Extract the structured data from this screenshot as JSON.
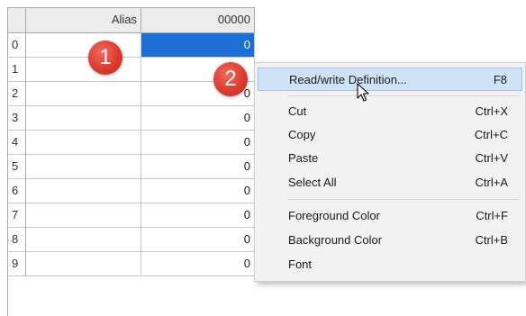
{
  "grid": {
    "columns": [
      "Alias",
      "00000"
    ],
    "rows": [
      {
        "index": "0",
        "alias": "",
        "value": "0",
        "selected": true
      },
      {
        "index": "1",
        "alias": "",
        "value": ""
      },
      {
        "index": "2",
        "alias": "",
        "value": "0"
      },
      {
        "index": "3",
        "alias": "",
        "value": "0"
      },
      {
        "index": "4",
        "alias": "",
        "value": "0"
      },
      {
        "index": "5",
        "alias": "",
        "value": "0"
      },
      {
        "index": "6",
        "alias": "",
        "value": "0"
      },
      {
        "index": "7",
        "alias": "",
        "value": "0"
      },
      {
        "index": "8",
        "alias": "",
        "value": "0"
      },
      {
        "index": "9",
        "alias": "",
        "value": "0"
      }
    ]
  },
  "badges": {
    "step1": "1",
    "step2": "2",
    "color": "#dd3b2e"
  },
  "context_menu": {
    "items": [
      {
        "label": "Read/write Definition...",
        "shortcut": "F8",
        "highlighted": true
      },
      {
        "label": "Cut",
        "shortcut": "Ctrl+X"
      },
      {
        "label": "Copy",
        "shortcut": "Ctrl+C"
      },
      {
        "label": "Paste",
        "shortcut": "Ctrl+V"
      },
      {
        "label": "Select All",
        "shortcut": "Ctrl+A"
      },
      {
        "label": "Foreground Color",
        "shortcut": "Ctrl+F"
      },
      {
        "label": "Background Color",
        "shortcut": "Ctrl+B"
      },
      {
        "label": "Font",
        "shortcut": ""
      }
    ]
  },
  "colors": {
    "selection": "#1c6fd6",
    "menu_highlight": "#cfe3f7"
  }
}
